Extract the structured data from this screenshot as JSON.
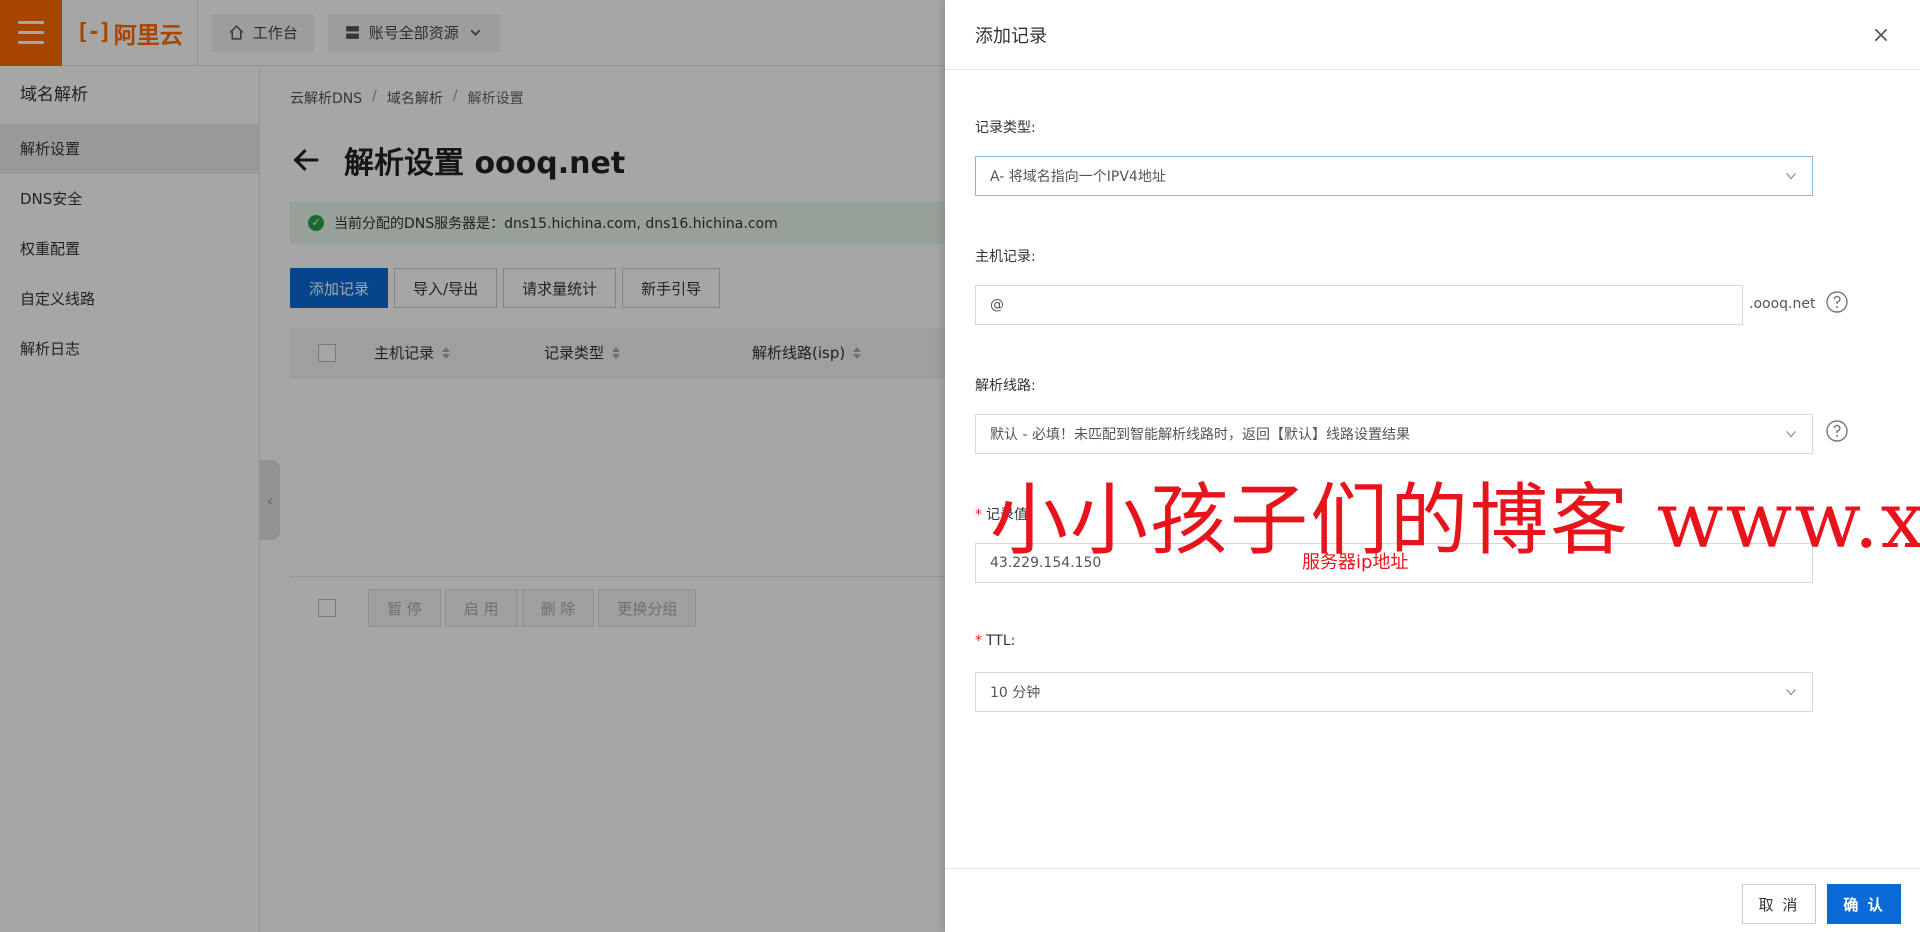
{
  "topbar": {
    "logo_mark": "[-]",
    "logo_text": "阿里云",
    "workbench_label": "工作台",
    "resources_label": "账号全部资源"
  },
  "sidebar": {
    "title": "域名解析",
    "items": [
      {
        "label": "解析设置",
        "active": true
      },
      {
        "label": "DNS安全"
      },
      {
        "label": "权重配置"
      },
      {
        "label": "自定义线路"
      },
      {
        "label": "解析日志"
      }
    ]
  },
  "main": {
    "breadcrumb": [
      "云解析DNS",
      "域名解析",
      "解析设置"
    ],
    "page_title": "解析设置 oooq.net",
    "notice": "当前分配的DNS服务器是：dns15.hichina.com, dns16.hichina.com",
    "toolbar": {
      "add": "添加记录",
      "import_export": "导入/导出",
      "request_stats": "请求量统计",
      "guide": "新手引导"
    },
    "columns": [
      "主机记录",
      "记录类型",
      "解析线路(isp)"
    ],
    "footer_buttons": {
      "pause": "暂 停",
      "enable": "启 用",
      "delete": "删 除",
      "change_group": "更换分组"
    }
  },
  "drawer": {
    "title": "添加记录",
    "record_type": {
      "label": "记录类型:",
      "value": "A- 将域名指向一个IPV4地址"
    },
    "host": {
      "label": "主机记录:",
      "value": "@",
      "suffix": ".oooq.net"
    },
    "line": {
      "label": "解析线路:",
      "value": "默认 - 必填！未匹配到智能解析线路时，返回【默认】线路设置结果"
    },
    "record_value": {
      "label": "记录值:",
      "value": "43.229.154.150"
    },
    "ttl": {
      "label": "TTL:",
      "value": "10 分钟"
    },
    "cancel": "取 消",
    "confirm": "确 认"
  },
  "overlay": {
    "watermark": "小小孩子们的博客 www.xx",
    "annotation": "服务器ip地址"
  },
  "colors": {
    "brand": "#ff6a00",
    "primary": "#0a6ad6",
    "success": "#22a346",
    "watermark": "#e8141b"
  }
}
